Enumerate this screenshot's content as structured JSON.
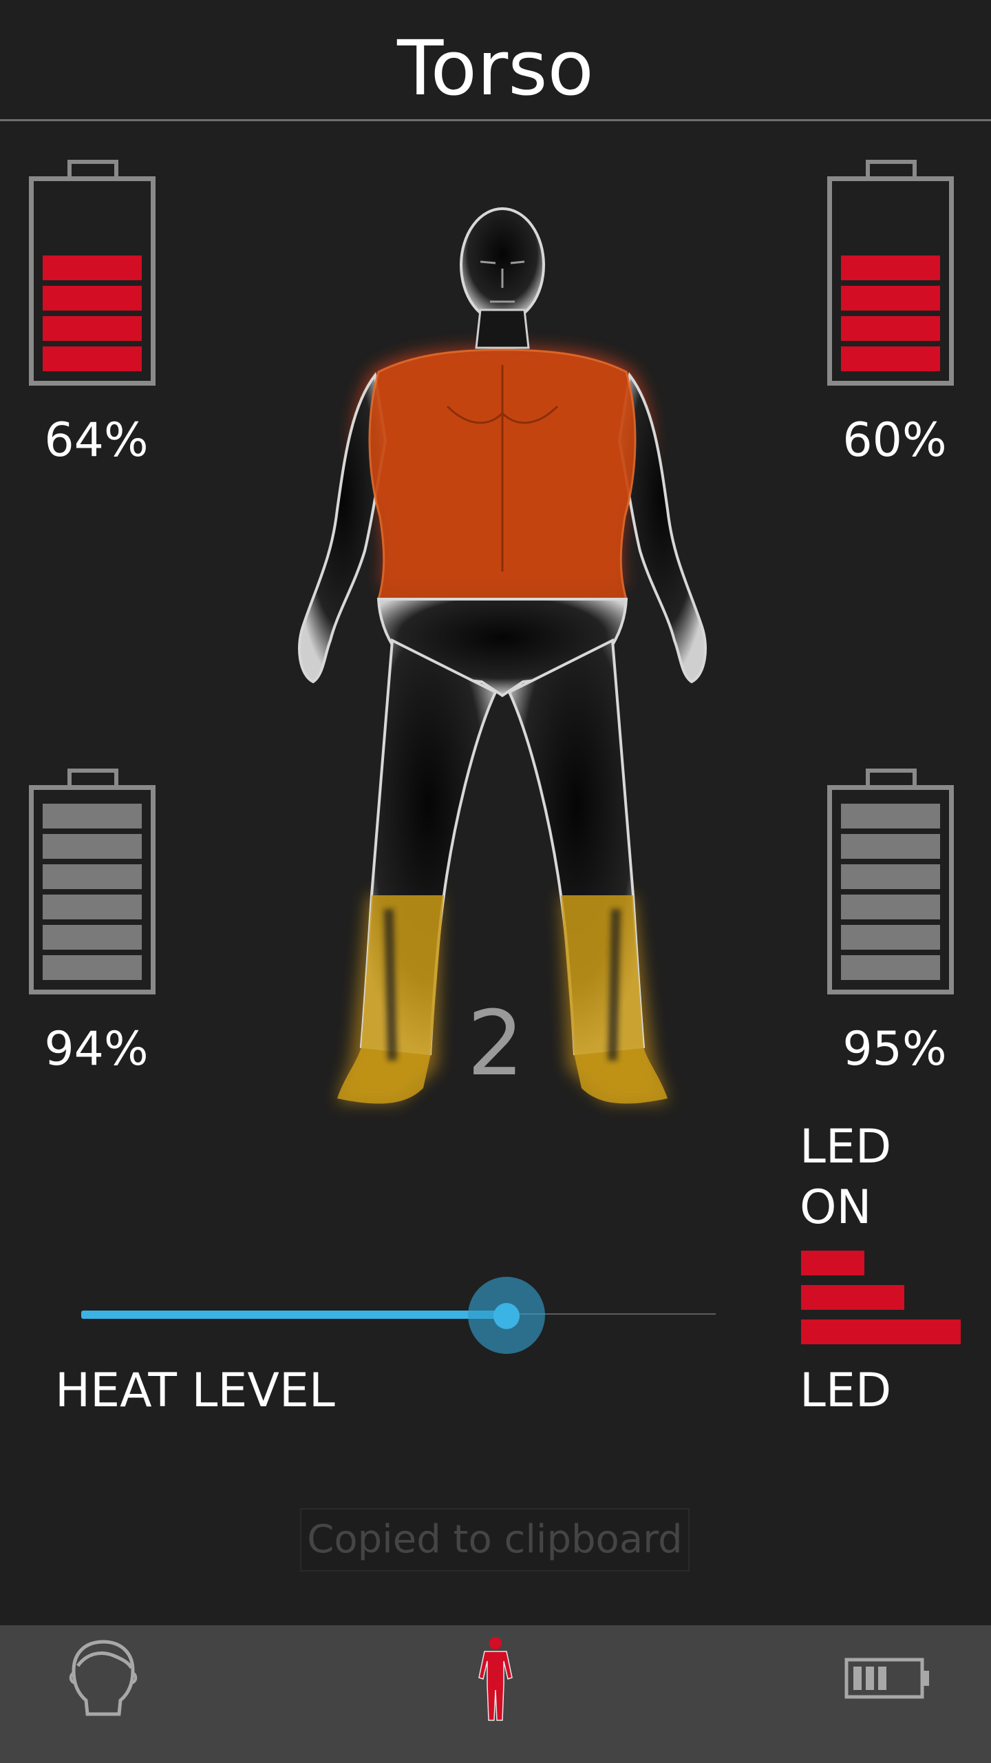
{
  "header": {
    "title": "Torso"
  },
  "batteries": {
    "top_left": {
      "label": "64%",
      "level_bars": 4,
      "total_bars": 6,
      "color": "#d30d24"
    },
    "top_right": {
      "label": "60%",
      "level_bars": 4,
      "total_bars": 6,
      "color": "#d30d24"
    },
    "bottom_left": {
      "label": "94%",
      "level_bars": 6,
      "total_bars": 6,
      "color": "#7a7a7a"
    },
    "bottom_right": {
      "label": "95%",
      "level_bars": 6,
      "total_bars": 6,
      "color": "#7a7a7a"
    }
  },
  "body_figure": {
    "icon": "human-body-heat-map",
    "torso_heat_color": "#c8460f",
    "feet_heat_color": "#c99a16"
  },
  "heat": {
    "number": "2",
    "label": "HEAT LEVEL",
    "slider_fraction": 0.67,
    "accent": "#3bb3e4"
  },
  "led": {
    "status_line1": "LED",
    "status_line2": "ON",
    "label": "LED",
    "icon": "led-bars-icon",
    "color": "#d30d24"
  },
  "toast": {
    "text": "Copied to clipboard"
  },
  "nav": {
    "items": [
      {
        "icon": "head-icon"
      },
      {
        "icon": "body-icon",
        "active_color": "#d30d24"
      },
      {
        "icon": "battery-icon"
      }
    ]
  }
}
